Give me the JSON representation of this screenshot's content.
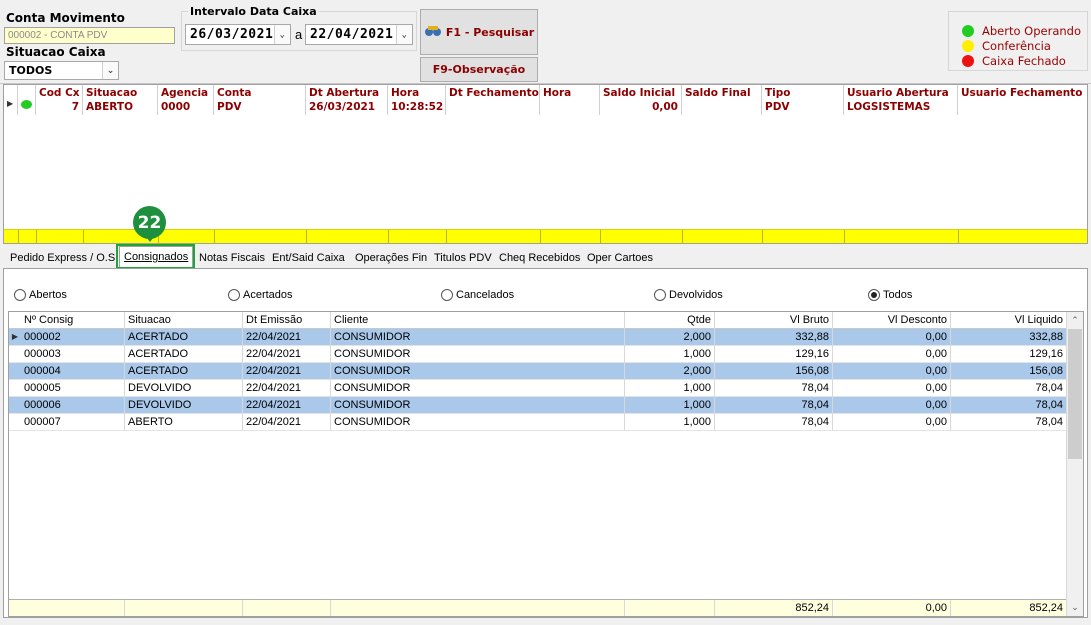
{
  "filters": {
    "conta_label": "Conta Movimento",
    "conta_value": "000002 - CONTA PDV",
    "situacao_label": "Situacao Caixa",
    "situacao_value": "TODOS",
    "intervalo_label": "Intervalo Data Caixa",
    "date_from": "26/03/2021",
    "date_sep": "a",
    "date_to": "22/04/2021",
    "search_button": "F1 - Pesquisar",
    "obs_button": "F9-Observação"
  },
  "legend": [
    {
      "label": "Aberto Operando",
      "color": "#22cc22"
    },
    {
      "label": "Conferência",
      "color": "#ffee00"
    },
    {
      "label": "Caixa Fechado",
      "color": "#ee1111"
    }
  ],
  "caixa_grid": {
    "columns": [
      "Cod Cx",
      "Situacao",
      "Agencia",
      "Conta",
      "Dt Abertura",
      "Hora",
      "Dt Fechamento",
      "Hora",
      "Saldo Inicial",
      "Saldo Final",
      "Tipo",
      "Usuario Abertura",
      "Usuario Fechamento"
    ],
    "row": [
      "7",
      "ABERTO",
      "0000",
      "PDV",
      "26/03/2021",
      "10:28:52",
      "",
      "",
      "0,00",
      "",
      "PDV",
      "LOGSISTEMAS",
      ""
    ],
    "status_color": "#22cc22"
  },
  "tabs": [
    {
      "label": "Pedido Express / O.S",
      "active": false
    },
    {
      "label": "Consignados",
      "active": true
    },
    {
      "label": "Notas Fiscais",
      "active": false
    },
    {
      "label": "Ent/Said Caixa",
      "active": false
    },
    {
      "label": "Operações Fin",
      "active": false
    },
    {
      "label": "Titulos PDV",
      "active": false
    },
    {
      "label": "Cheq Recebidos",
      "active": false
    },
    {
      "label": "Oper Cartoes",
      "active": false
    }
  ],
  "step_badge": "22",
  "radios": [
    {
      "label": "Abertos",
      "checked": false
    },
    {
      "label": "Acertados",
      "checked": false
    },
    {
      "label": "Cancelados",
      "checked": false
    },
    {
      "label": "Devolvidos",
      "checked": false
    },
    {
      "label": "Todos",
      "checked": true
    }
  ],
  "consig_table": {
    "headers": [
      "Nº Consig",
      "Situacao",
      "Dt Emissão",
      "Cliente",
      "Qtde",
      "Vl Bruto",
      "Vl Desconto",
      "Vl Liquido"
    ],
    "rows": [
      [
        "000002",
        "ACERTADO",
        "22/04/2021",
        "CONSUMIDOR",
        "2,000",
        "332,88",
        "0,00",
        "332,88"
      ],
      [
        "000003",
        "ACERTADO",
        "22/04/2021",
        "CONSUMIDOR",
        "1,000",
        "129,16",
        "0,00",
        "129,16"
      ],
      [
        "000004",
        "ACERTADO",
        "22/04/2021",
        "CONSUMIDOR",
        "2,000",
        "156,08",
        "0,00",
        "156,08"
      ],
      [
        "000005",
        "DEVOLVIDO",
        "22/04/2021",
        "CONSUMIDOR",
        "1,000",
        "78,04",
        "0,00",
        "78,04"
      ],
      [
        "000006",
        "DEVOLVIDO",
        "22/04/2021",
        "CONSUMIDOR",
        "1,000",
        "78,04",
        "0,00",
        "78,04"
      ],
      [
        "000007",
        "ABERTO",
        "22/04/2021",
        "CONSUMIDOR",
        "1,000",
        "78,04",
        "0,00",
        "78,04"
      ]
    ],
    "selected_rows": [
      0,
      2,
      4
    ],
    "totals": {
      "bruto": "852,24",
      "desconto": "0,00",
      "liquido": "852,24"
    }
  }
}
